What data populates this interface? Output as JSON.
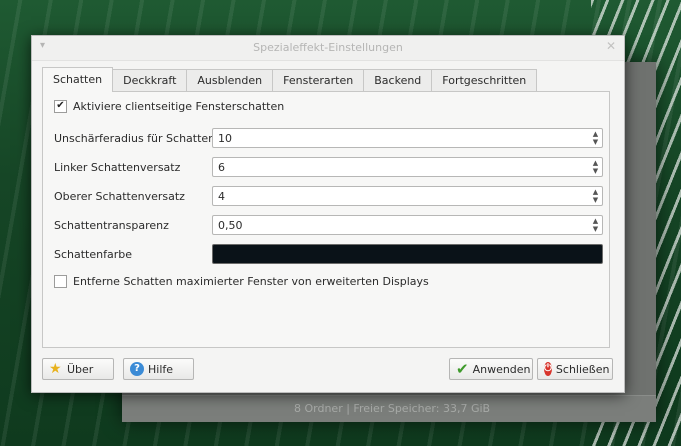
{
  "window_title": "Spezialeffekt-Einstellungen",
  "background_window": {
    "status_text": "8 Ordner  |  Freier Speicher: 33,7 GiB"
  },
  "tabs": [
    {
      "label": "Schatten",
      "active": true
    },
    {
      "label": "Deckkraft",
      "active": false
    },
    {
      "label": "Ausblenden",
      "active": false
    },
    {
      "label": "Fensterarten",
      "active": false
    },
    {
      "label": "Backend",
      "active": false
    },
    {
      "label": "Fortgeschritten",
      "active": false
    }
  ],
  "shadow_tab": {
    "enable_checkbox": {
      "label": "Aktiviere clientseitige Fensterschatten",
      "checked": true
    },
    "fields": [
      {
        "label": "Unschärferadius für Schatten",
        "value": "10"
      },
      {
        "label": "Linker Schattenversatz",
        "value": "6"
      },
      {
        "label": "Oberer Schattenversatz",
        "value": "4"
      },
      {
        "label": "Schattentransparenz",
        "value": "0,50"
      }
    ],
    "color_field": {
      "label": "Schattenfarbe",
      "color": "#0a1218"
    },
    "remove_checkbox": {
      "label": "Entferne Schatten maximierter Fenster von erweiterten Displays",
      "checked": false
    }
  },
  "buttons": {
    "about": "Über",
    "help": "Hilfe",
    "apply": "Anwenden",
    "close": "Schließen"
  },
  "icons": {
    "about": "star-icon",
    "help": "help-icon",
    "apply": "checkmark-icon",
    "close": "power-icon"
  }
}
